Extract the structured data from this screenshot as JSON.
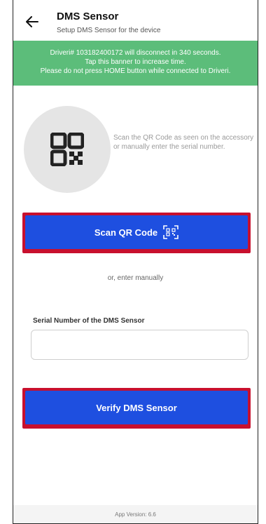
{
  "header": {
    "title": "DMS Sensor",
    "subtitle": "Setup DMS Sensor for the device",
    "back_icon": "arrow-left-icon"
  },
  "banner": {
    "line1": "Driveri# 103182400172 will disconnect in 340 seconds.",
    "line2": "Tap this banner to increase time.",
    "line3": "Please do not press HOME button while connected to Driveri.",
    "color": "#5cbd7a"
  },
  "qr": {
    "icon": "qr-code-icon",
    "hint": "Scan the QR Code as seen on the accessory or manually enter the serial number."
  },
  "scan_button": {
    "label": "Scan QR Code",
    "icon": "qr-scan-icon",
    "color": "#1e4fe0",
    "highlight_color": "#c8102e"
  },
  "or_text": "or, enter manually",
  "serial": {
    "label": "Serial Number of the DMS Sensor",
    "value": "",
    "placeholder": ""
  },
  "verify_button": {
    "label": "Verify DMS Sensor",
    "color": "#1e4fe0",
    "highlight_color": "#c8102e"
  },
  "footer": {
    "version": "App Version: 6.6"
  }
}
